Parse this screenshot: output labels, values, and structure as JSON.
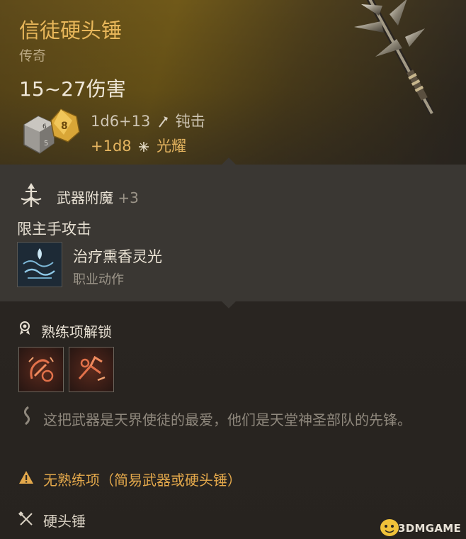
{
  "item": {
    "name": "信徒硬头锤",
    "rarity": "传奇",
    "damage_range": "15~27伤害",
    "damage_main": "1d6+13",
    "damage_main_type": "钝击",
    "damage_bonus": "+1d8",
    "damage_bonus_type": "光耀",
    "dice": {
      "d6_faces": [
        "6",
        "5"
      ],
      "d8_face": "8"
    }
  },
  "enchantment": {
    "label": "武器附魔",
    "value": "+3",
    "restriction": "限主手攻击",
    "action_name": "治疗熏香灵光",
    "action_type": "职业动作"
  },
  "proficiency": {
    "label": "熟练项解锁",
    "skills": [
      "skill-1-icon",
      "skill-2-icon"
    ]
  },
  "flavor_text": "这把武器是天界使徒的最爱，他们是天堂神圣部队的先锋。",
  "warning": "无熟练项（简易武器或硬头锤）",
  "weapon_type": "硬头锤",
  "watermark": "3DMGAME",
  "colors": {
    "title": "#e8b75a",
    "bonus": "#e5b560",
    "warning": "#e3a84b",
    "muted": "#9b9488"
  }
}
